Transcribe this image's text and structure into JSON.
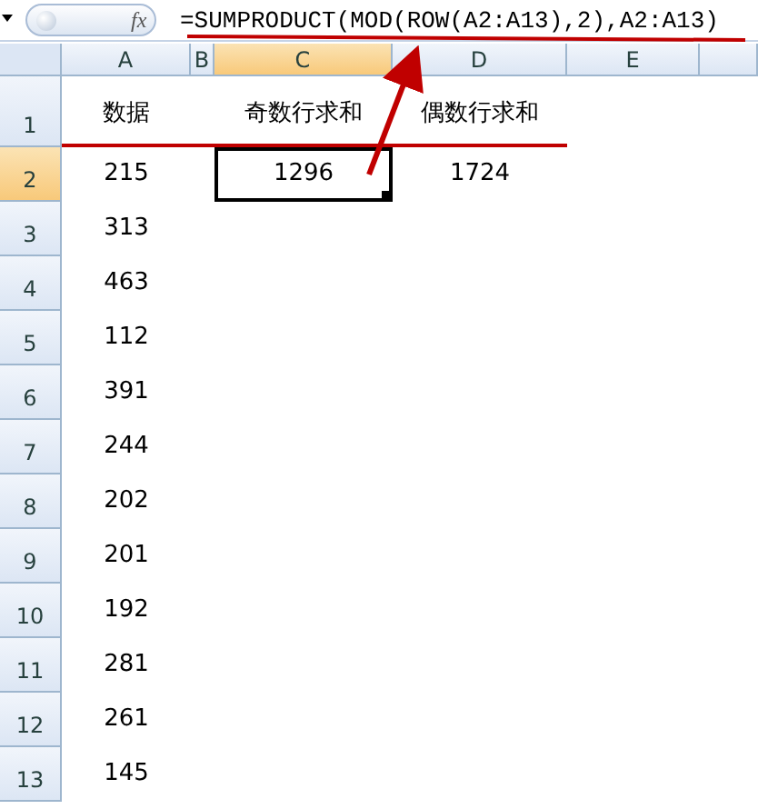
{
  "formula_bar": {
    "function_icon": "fx",
    "formula": "=SUMPRODUCT(MOD(ROW(A2:A13),2),A2:A13)"
  },
  "columns": [
    {
      "label": "A",
      "selected": false
    },
    {
      "label": "B",
      "selected": false
    },
    {
      "label": "C",
      "selected": true
    },
    {
      "label": "D",
      "selected": false
    },
    {
      "label": "E",
      "selected": false
    }
  ],
  "rows": [
    {
      "header": "1",
      "selected": false,
      "cells": {
        "a": {
          "text": "数据",
          "selected": false
        },
        "c": {
          "text": "奇数行求和",
          "selected": false
        },
        "d": {
          "text": "偶数行求和",
          "selected": false
        }
      }
    },
    {
      "header": "2",
      "selected": true,
      "cells": {
        "a": {
          "text": "215",
          "selected": false
        },
        "c": {
          "text": "1296",
          "selected": true
        },
        "d": {
          "text": "1724",
          "selected": false
        }
      }
    },
    {
      "header": "3",
      "selected": false,
      "cells": {
        "a": {
          "text": "313",
          "selected": false
        }
      }
    },
    {
      "header": "4",
      "selected": false,
      "cells": {
        "a": {
          "text": "463",
          "selected": false
        }
      }
    },
    {
      "header": "5",
      "selected": false,
      "cells": {
        "a": {
          "text": "112",
          "selected": false
        }
      }
    },
    {
      "header": "6",
      "selected": false,
      "cells": {
        "a": {
          "text": "391",
          "selected": false
        }
      }
    },
    {
      "header": "7",
      "selected": false,
      "cells": {
        "a": {
          "text": "244",
          "selected": false
        }
      }
    },
    {
      "header": "8",
      "selected": false,
      "cells": {
        "a": {
          "text": "202",
          "selected": false
        }
      }
    },
    {
      "header": "9",
      "selected": false,
      "cells": {
        "a": {
          "text": "201",
          "selected": false
        }
      }
    },
    {
      "header": "10",
      "selected": false,
      "cells": {
        "a": {
          "text": "192",
          "selected": false
        }
      }
    },
    {
      "header": "11",
      "selected": false,
      "cells": {
        "a": {
          "text": "281",
          "selected": false
        }
      }
    },
    {
      "header": "12",
      "selected": false,
      "cells": {
        "a": {
          "text": "261",
          "selected": false
        }
      }
    },
    {
      "header": "13",
      "selected": false,
      "cells": {
        "a": {
          "text": "145",
          "selected": false
        }
      }
    }
  ]
}
